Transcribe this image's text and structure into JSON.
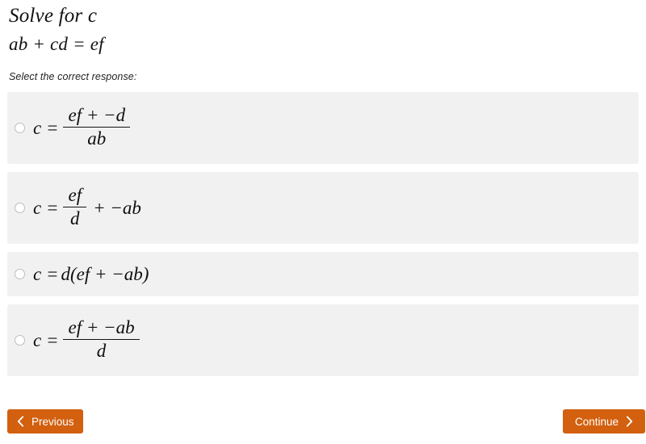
{
  "question": {
    "title": "Solve for c",
    "equation": "ab + cd = ef",
    "prompt": "Select the correct response:"
  },
  "options": [
    {
      "id": "option-a",
      "lhs": "c =",
      "form": "fraction",
      "numerator": "ef + −d",
      "denominator": "ab",
      "plain": "c = (ef + −d) / ab"
    },
    {
      "id": "option-b",
      "lhs": "c =",
      "form": "fraction-plus",
      "numerator": "ef",
      "denominator": "d",
      "tail": "+ −ab",
      "plain": "c = ef/d + −ab"
    },
    {
      "id": "option-c",
      "lhs": "c =",
      "form": "inline",
      "expression": "d(ef + −ab)",
      "plain": "c = d(ef + −ab)"
    },
    {
      "id": "option-d",
      "lhs": "c =",
      "form": "fraction",
      "numerator": "ef + −ab",
      "denominator": "d",
      "plain": "c = (ef + −ab) / d"
    }
  ],
  "footer": {
    "previous_label": "Previous",
    "continue_label": "Continue",
    "previous_icon": "chevron-left-icon",
    "continue_icon": "chevron-right-icon"
  },
  "colors": {
    "button": "#d2600f",
    "option_background": "#f1f1f1",
    "page_background": "#ffffff",
    "radio_border": "#bdbdbd"
  }
}
